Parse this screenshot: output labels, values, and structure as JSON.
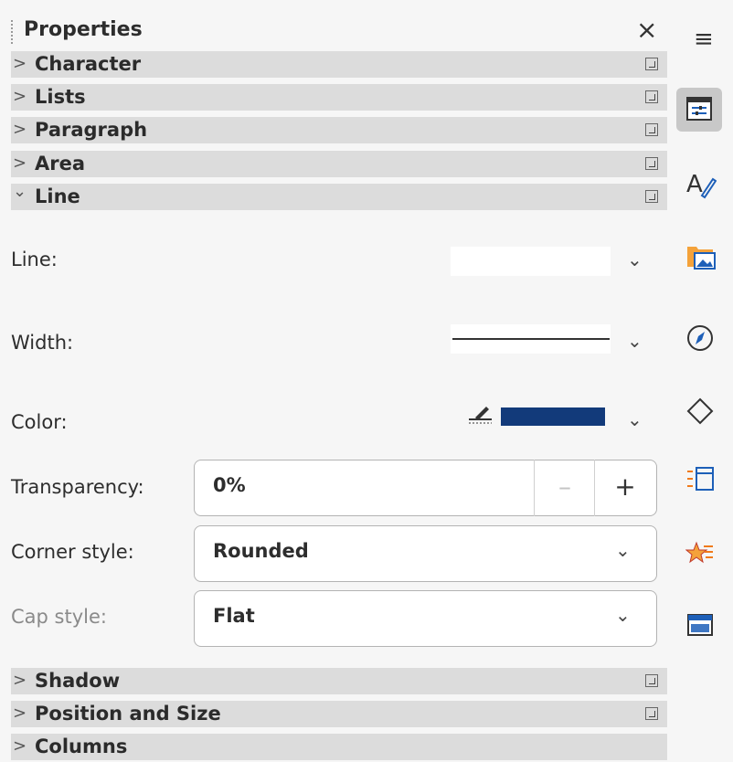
{
  "panel": {
    "title": "Properties",
    "close_symbol": "×",
    "sections_top": [
      {
        "label": "Character",
        "expanded": false
      },
      {
        "label": "Lists",
        "expanded": false
      },
      {
        "label": "Paragraph",
        "expanded": false
      },
      {
        "label": "Area",
        "expanded": false
      },
      {
        "label": "Line",
        "expanded": true
      }
    ],
    "line": {
      "line_label": "Line:",
      "width_label": "Width:",
      "color_label": "Color:",
      "color_value": "#123a7a",
      "transparency_label": "Transparency:",
      "transparency_value": "0%",
      "minus": "–",
      "plus": "+",
      "corner_label": "Corner style:",
      "corner_value": "Rounded",
      "cap_label": "Cap style:",
      "cap_value": "Flat"
    },
    "sections_bottom": [
      {
        "label": "Shadow",
        "expanded": false
      },
      {
        "label": "Position and Size",
        "expanded": false
      },
      {
        "label": "Columns",
        "expanded": false
      }
    ]
  },
  "sidebar": {
    "menu_symbol": "≡",
    "tabs": [
      "properties-icon",
      "styles-icon",
      "gallery-icon",
      "navigator-icon",
      "shapes-icon",
      "animation-icon",
      "slide-transition-icon",
      "master-slides-icon"
    ]
  }
}
